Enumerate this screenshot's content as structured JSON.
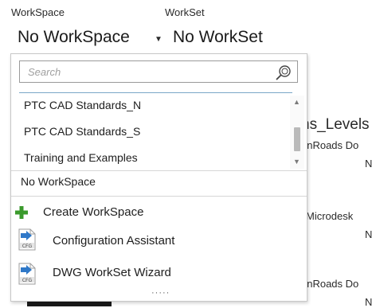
{
  "header": {
    "workspace_label": "WorkSpace",
    "workset_label": "WorkSet",
    "workspace_value": "No WorkSpace",
    "workset_value": "No WorkSet"
  },
  "dropdown": {
    "search_placeholder": "Search",
    "items": [
      "PTC CAD Standards_N",
      "PTC CAD Standards_S",
      "Training and Examples"
    ],
    "current_workspace": "No WorkSpace",
    "commands": [
      {
        "label": "Create WorkSpace",
        "icon": "plus-icon"
      },
      {
        "label": "Configuration Assistant",
        "icon": "cfg-icon"
      },
      {
        "label": "DWG WorkSet Wizard",
        "icon": "cfg-icon"
      }
    ],
    "more_indicator": "·····"
  },
  "background": {
    "levels_text": "ns_Levels",
    "openroads_1": "enRoads Do",
    "n_1": "N",
    "microdesk": "Microdesk",
    "n_2": "N",
    "openroads_2": "enRoads Do",
    "n_3": "N"
  },
  "colors": {
    "plus_green": "#3a9a2c",
    "cfg_blue": "#2f78c8"
  }
}
